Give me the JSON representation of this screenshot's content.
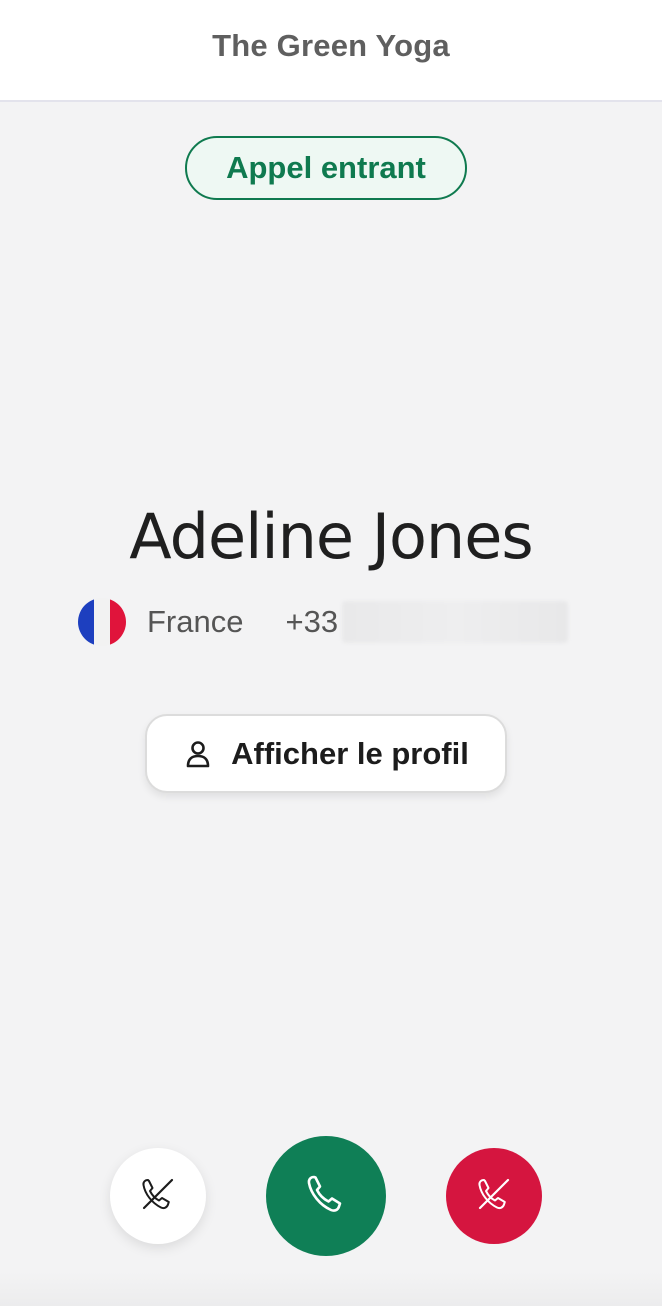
{
  "header": {
    "title": "The Green Yoga"
  },
  "call": {
    "status_label": "Appel entrant",
    "caller_name": "Adeline Jones",
    "country": "France",
    "phone_prefix": "+33",
    "flag_icon": "france-flag-icon"
  },
  "actions": {
    "profile_label": "Afficher le profil",
    "profile_icon": "user-icon",
    "mute_icon": "phone-off-icon",
    "answer_icon": "phone-icon",
    "decline_icon": "phone-off-icon"
  },
  "colors": {
    "accent_green": "#0f7f56",
    "decline_red": "#d5153f",
    "badge_border": "#0f7a4f",
    "badge_background": "#eef8f3"
  }
}
